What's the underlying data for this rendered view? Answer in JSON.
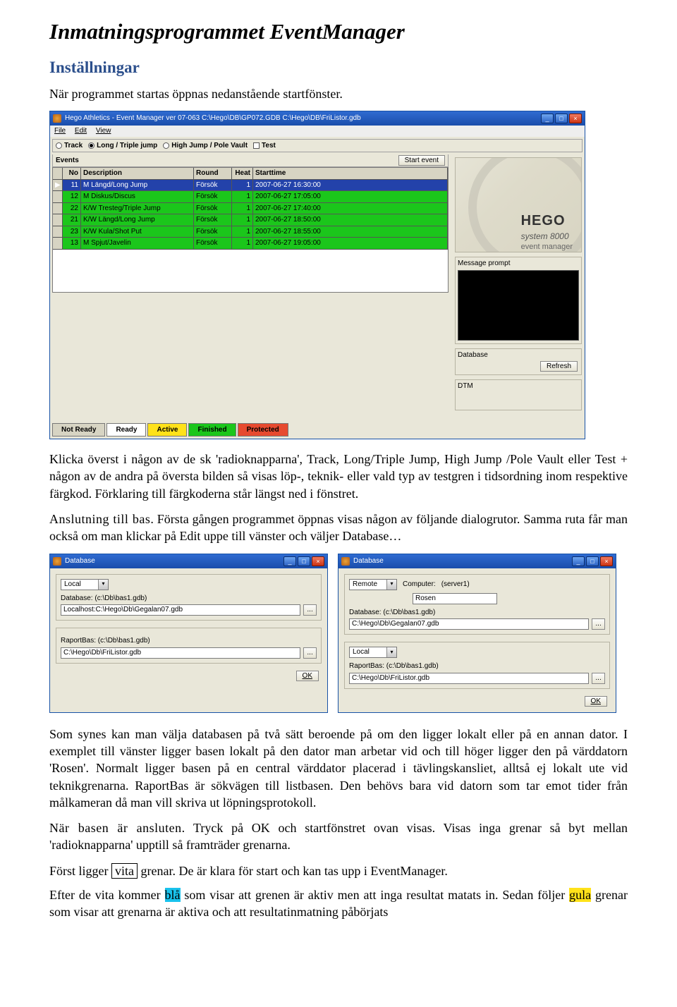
{
  "doc": {
    "title": "Inmatningsprogrammet EventManager",
    "h2": "Inställningar",
    "intro": "När programmet startas öppnas nedanstående startfönster.",
    "para2": "Klicka överst i någon av de sk 'radioknapparna', Track, Long/Triple Jump, High Jump /Pole Vault eller Test + någon av de andra på översta bilden så visas löp-, teknik- eller vald typ av testgren i tidsordning inom respektive färgkod. Förklaring till färgkoderna står längst ned i fönstret.",
    "para3a": "Anslutning till bas",
    "para3b": ". Första gången programmet öppnas visas någon av följande dialogrutor. Samma ruta får man också om man klickar på Edit uppe till vänster och väljer Database…",
    "para4": "Som synes kan man välja databasen på två sätt beroende på om den ligger lokalt eller på en annan dator. I exemplet till vänster ligger basen lokalt på den dator man arbetar vid och till höger ligger den på värddatorn 'Rosen'. Normalt ligger basen på en central värddator placerad i tävlingskansliet, alltså ej lokalt ute vid teknikgrenarna. RaportBas är sökvägen till listbasen. Den behövs bara vid datorn som tar emot tider från målkameran då man vill skriva ut löpningsprotokoll.",
    "para5a": "När basen är ansluten.",
    "para5b": " Tryck på OK och startfönstret ovan visas. Visas inga grenar så byt mellan 'radioknapparna' upptill så framträder grenarna.",
    "para6a": "Först ligger ",
    "para6_boxed": "vita",
    "para6b": " grenar. De är klara för start och kan tas upp i EventManager.",
    "para7a": "Efter de vita kommer ",
    "para7_blue": "blå",
    "para7b": " som visar att grenen är aktiv men att inga resultat matats in. Sedan följer ",
    "para7_yel": "gula",
    "para7c": " grenar som visar att grenarna är aktiva och att resultatinmatning påbörjats"
  },
  "win": {
    "title": "Hego Athletics - Event Manager ver 07-063  C:\\Hego\\DB\\GP072.GDB C:\\Hego\\DB\\FriListor.gdb",
    "menu": {
      "file": "File",
      "edit": "Edit",
      "view": "View"
    },
    "radio": {
      "track": "Track",
      "long": "Long / Triple jump",
      "high": "High Jump / Pole Vault",
      "test": "Test"
    },
    "events_label": "Events",
    "start_event": "Start event",
    "columns": {
      "no": "No",
      "desc": "Description",
      "round": "Round",
      "heat": "Heat",
      "start": "Starttime"
    },
    "rows": [
      {
        "no": "11",
        "desc": "M Längd/Long Jump",
        "round": "Försök",
        "heat": "1",
        "start": "2007-06-27 16:30:00",
        "sel": true
      },
      {
        "no": "12",
        "desc": "M Diskus/Discus",
        "round": "Försök",
        "heat": "1",
        "start": "2007-06-27 17:05:00",
        "sel": false
      },
      {
        "no": "22",
        "desc": "K/W Tresteg/Triple Jump",
        "round": "Försök",
        "heat": "1",
        "start": "2007-06-27 17:40:00",
        "sel": false
      },
      {
        "no": "21",
        "desc": "K/W Längd/Long Jump",
        "round": "Försök",
        "heat": "1",
        "start": "2007-06-27 18:50:00",
        "sel": false
      },
      {
        "no": "23",
        "desc": "K/W Kula/Shot Put",
        "round": "Försök",
        "heat": "1",
        "start": "2007-06-27 18:55:00",
        "sel": false
      },
      {
        "no": "13",
        "desc": "M Spjut/Javelin",
        "round": "Försök",
        "heat": "1",
        "start": "2007-06-27 19:05:00",
        "sel": false
      }
    ],
    "logo": {
      "big": "HEGO",
      "mid": "system 8000",
      "sml": "event manager"
    },
    "msg_label": "Message prompt",
    "db_label": "Database",
    "refresh": "Refresh",
    "dtm_label": "DTM",
    "legend": {
      "notready": "Not Ready",
      "ready": "Ready",
      "active": "Active",
      "finished": "Finished",
      "protected": "Protected"
    }
  },
  "dlgL": {
    "title": "Database",
    "conn": "Local",
    "dblabel": "Database:   (c:\\Db\\bas1.gdb)",
    "dbpath": "Localhost:C:\\Hego\\Db\\Gegalan07.gdb",
    "rblabel": "RaportBas:   (c:\\Db\\bas1.gdb)",
    "rbpath": "C:\\Hego\\Db\\FriListor.gdb",
    "ok": "OK"
  },
  "dlgR": {
    "title": "Database",
    "conn": "Remote",
    "computer_lbl": "Computer:",
    "server": "(server1)",
    "computer": "Rosen",
    "dblabel": "Database:   (c:\\Db\\bas1.gdb)",
    "dbpath": "C:\\Hego\\Db\\Gegalan07.gdb",
    "conn2": "Local",
    "rblabel": "RaportBas:   (c:\\Db\\bas1.gdb)",
    "rbpath": "C:\\Hego\\Db\\FriListor.gdb",
    "ok": "OK"
  }
}
